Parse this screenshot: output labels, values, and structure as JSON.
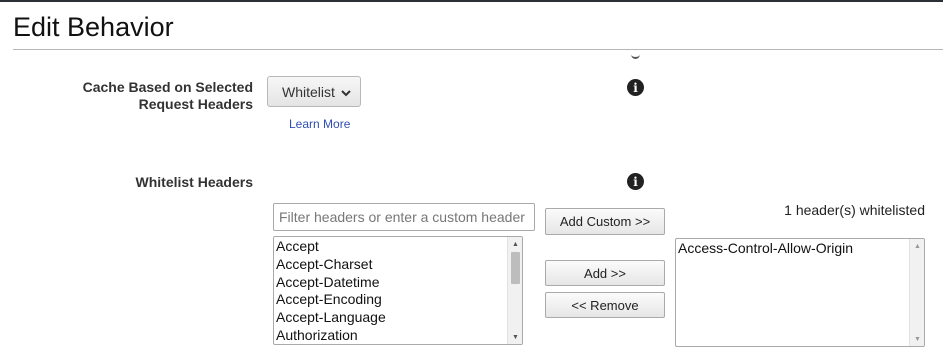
{
  "page": {
    "title": "Edit Behavior"
  },
  "cache_headers": {
    "label": "Cache Based on Selected Request Headers",
    "dropdown": {
      "selected": "Whitelist",
      "icon": "chevron-down-icon"
    },
    "learn_more": "Learn More",
    "info_icon": "i"
  },
  "whitelist_headers": {
    "label": "Whitelist Headers",
    "info_icon": "i",
    "filter": {
      "placeholder": "Filter headers or enter a custom header",
      "value": ""
    },
    "available": [
      "Accept",
      "Accept-Charset",
      "Accept-Datetime",
      "Accept-Encoding",
      "Accept-Language",
      "Authorization"
    ],
    "buttons": {
      "add_custom": "Add Custom >>",
      "add": "Add >>",
      "remove": "<< Remove"
    },
    "count_text": "1 header(s) whitelisted",
    "selected": [
      "Access-Control-Allow-Origin"
    ]
  }
}
